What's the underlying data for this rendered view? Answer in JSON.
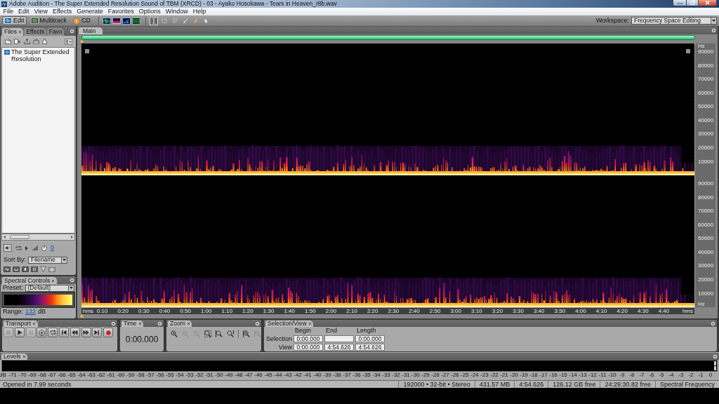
{
  "window": {
    "title": "Adobe Audition - The Super Extended Resolution Sound of TBM (XRCD) - 03 - Ayako Hosokawa - Tears in Heaven_r8b.wav"
  },
  "menu": [
    "File",
    "Edit",
    "View",
    "Effects",
    "Generate",
    "Favorites",
    "Options",
    "Window",
    "Help"
  ],
  "toolbar": {
    "modes": [
      {
        "kind": "edit",
        "label": "Edit",
        "selected": true
      },
      {
        "kind": "multitrack",
        "label": "Multitrack",
        "selected": false
      },
      {
        "kind": "cd",
        "label": "CD",
        "selected": false
      }
    ],
    "views": [
      {
        "kind": "waveform"
      },
      {
        "kind": "spectral-frequency"
      },
      {
        "kind": "spectral-pan"
      },
      {
        "kind": "spectral-phase"
      }
    ],
    "tools": [
      {
        "kind": "time-selection",
        "selected": true
      },
      {
        "kind": "marquee",
        "selected": false
      },
      {
        "kind": "lasso",
        "selected": false
      },
      {
        "kind": "brush",
        "selected": false
      },
      {
        "kind": "healing",
        "selected": false
      },
      {
        "kind": "scrub",
        "selected": false
      }
    ],
    "workspace": {
      "label": "Workspace:",
      "value": "Frequency Space Editing"
    }
  },
  "files_panel": {
    "tabs": [
      {
        "label": "Files",
        "selected": true
      },
      {
        "label": "Effects",
        "selected": false
      },
      {
        "label": "Favo",
        "selected": false
      }
    ],
    "files": [
      "The Super Extended Resolution"
    ],
    "volume": "0",
    "sort_by": {
      "label": "Sort By:",
      "value": "Filename"
    }
  },
  "spectral_controls": {
    "title": "Spectral Controls",
    "preset_label": "Preset:",
    "preset": "(Default)",
    "range_label": "Range:",
    "range": "132",
    "range_unit": "dB"
  },
  "editor": {
    "tab": "Main",
    "frequency_axis": {
      "unit_top": "Hz",
      "channels": [
        [
          "90000",
          "80000",
          "70000",
          "60000",
          "50000",
          "40000",
          "30000",
          "20000",
          "10000"
        ],
        [
          "90000",
          "80000",
          "70000",
          "60000",
          "50000",
          "40000",
          "30000",
          "20000",
          "10000"
        ]
      ],
      "unit_bottom": "Hz"
    },
    "time_axis": {
      "unit_start": "hms",
      "labels": [
        "0:10",
        "0:20",
        "0:30",
        "0:40",
        "0:50",
        "1:00",
        "1:10",
        "1:20",
        "1:30",
        "1:40",
        "1:50",
        "2:00",
        "2:10",
        "2:20",
        "2:30",
        "2:40",
        "2:50",
        "3:00",
        "3:10",
        "3:20",
        "3:30",
        "3:40",
        "3:50",
        "4:00",
        "4:10",
        "4:20",
        "4:30",
        "4:40"
      ],
      "unit_end": "hms"
    }
  },
  "transport": {
    "title": "Transport",
    "buttons": [
      {
        "kind": "stop",
        "disabled": true
      },
      {
        "kind": "play",
        "disabled": false
      },
      {
        "kind": "pause",
        "disabled": true
      },
      {
        "kind": "play-to-end",
        "disabled": false
      },
      {
        "kind": "loop",
        "disabled": false
      },
      {
        "kind": "go-to-start",
        "disabled": false
      },
      {
        "kind": "rewind",
        "disabled": false
      },
      {
        "kind": "fast-forward",
        "disabled": false
      },
      {
        "kind": "go-to-end",
        "disabled": false
      },
      {
        "kind": "record",
        "disabled": false
      }
    ]
  },
  "time": {
    "title": "Time",
    "value": "0:00.000"
  },
  "zoom": {
    "title": "Zoom",
    "tools": [
      {
        "kind": "in",
        "disabled": false
      },
      {
        "kind": "out",
        "disabled": true
      },
      {
        "kind": "out-full",
        "disabled": true
      },
      {
        "kind": "selection",
        "disabled": false
      },
      {
        "kind": "left",
        "disabled": false
      },
      {
        "kind": "right",
        "disabled": false
      },
      {
        "kind": "in-vertical",
        "disabled": false
      },
      {
        "kind": "out-vertical",
        "disabled": true
      }
    ]
  },
  "selection_view": {
    "title": "Selection/View",
    "columns": [
      "Begin",
      "End",
      "Length"
    ],
    "rows": [
      {
        "label": "Selection",
        "begin": "0:00.000",
        "length": "0:00.000"
      },
      {
        "label": "View",
        "begin": "0:00.000",
        "end": "4:54.626",
        "length": "4:54.626"
      }
    ]
  },
  "levels": {
    "title": "Levels",
    "scale": [
      "dB",
      "-71",
      "-70",
      "-69",
      "-68",
      "-67",
      "-66",
      "-65",
      "-64",
      "-63",
      "-62",
      "-61",
      "-60",
      "-59",
      "-58",
      "-57",
      "-56",
      "-55",
      "-54",
      "-53",
      "-52",
      "-51",
      "-50",
      "-49",
      "-48",
      "-47",
      "-46",
      "-45",
      "-44",
      "-43",
      "-42",
      "-41",
      "-40",
      "-39",
      "-38",
      "-37",
      "-36",
      "-35",
      "-34",
      "-33",
      "-32",
      "-31",
      "-30",
      "-29",
      "-28",
      "-27",
      "-26",
      "-25",
      "-24",
      "-23",
      "-22",
      "-21",
      "-20",
      "-19",
      "-18",
      "-17",
      "-16",
      "-15",
      "-14",
      "-13",
      "-12",
      "-11",
      "-10",
      "-9",
      "-8",
      "-7",
      "-6",
      "-5",
      "-4",
      "-3",
      "-2",
      "-1",
      "0"
    ]
  },
  "status_bar": {
    "message": "Opened in 7.99 seconds",
    "fields": [
      "192000 • 32-bit • Stereo",
      "431.57 MB",
      "4:54.626",
      "126.12 GB free",
      "24:29:30.82 free",
      "Spectral Frequency"
    ]
  }
}
